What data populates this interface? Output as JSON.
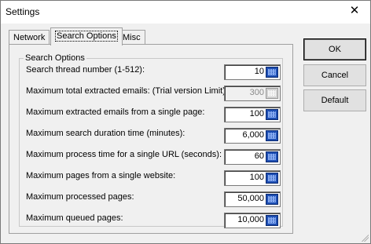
{
  "window": {
    "title": "Settings",
    "close_glyph": "✕"
  },
  "tabs": [
    {
      "label": "Network",
      "active": false
    },
    {
      "label": "Search Options",
      "active": true
    },
    {
      "label": "Misc",
      "active": false
    }
  ],
  "group": {
    "caption": "Search Options"
  },
  "rows": [
    {
      "label": "Search thread number (1-512):",
      "value": "10",
      "disabled": false
    },
    {
      "label": "Maximum total extracted emails: (Trial version Limit)",
      "value": "300",
      "disabled": true
    },
    {
      "label": "Maximum extracted emails from a single page:",
      "value": "100",
      "disabled": false
    },
    {
      "label": "Maximum search duration time (minutes):",
      "value": "6,000",
      "disabled": false
    },
    {
      "label": "Maximum process time for a single URL (seconds):",
      "value": "60",
      "disabled": false
    },
    {
      "label": "Maximum pages from a single website:",
      "value": "100",
      "disabled": false
    },
    {
      "label": "Maximum processed pages:",
      "value": "50,000",
      "disabled": false
    },
    {
      "label": "Maximum queued pages:",
      "value": "10,000",
      "disabled": false
    }
  ],
  "buttons": {
    "ok": "OK",
    "cancel": "Cancel",
    "default": "Default"
  },
  "colors": {
    "spin_button": "#1e4fb4",
    "window_bg": "#f0f0f0"
  },
  "icons": {
    "spin": "grid-spin-icon",
    "close": "close-icon"
  }
}
